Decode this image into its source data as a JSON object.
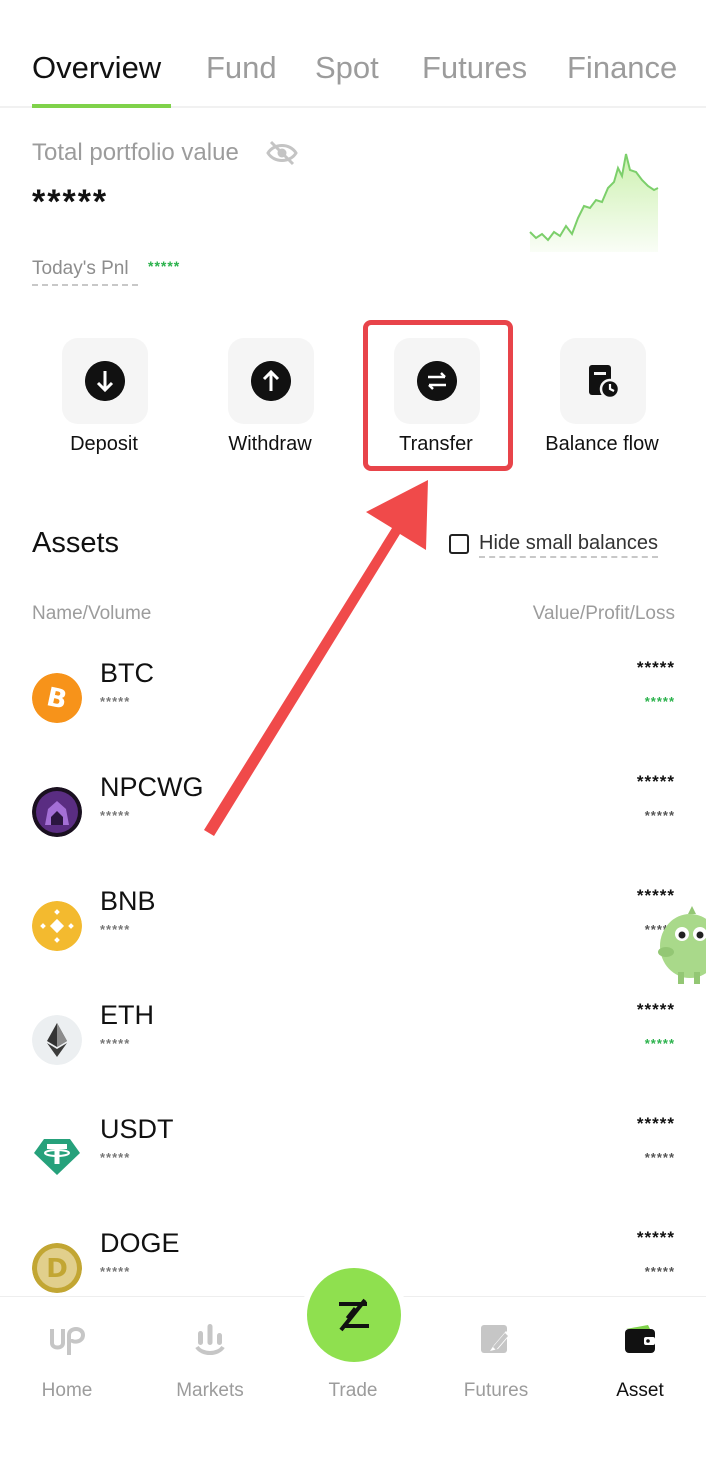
{
  "tabs": [
    {
      "label": "Overview",
      "active": true
    },
    {
      "label": "Fund",
      "active": false
    },
    {
      "label": "Spot",
      "active": false
    },
    {
      "label": "Futures",
      "active": false
    },
    {
      "label": "Finance",
      "active": false
    }
  ],
  "portfolio": {
    "label": "Total portfolio value",
    "value": "*****",
    "pnl_label": "Today's Pnl",
    "pnl_value": "*****"
  },
  "actions": [
    {
      "label": "Deposit",
      "icon": "arrow-down-icon"
    },
    {
      "label": "Withdraw",
      "icon": "arrow-up-icon"
    },
    {
      "label": "Transfer",
      "icon": "swap-icon"
    },
    {
      "label": "Balance flow",
      "icon": "balance-flow-icon"
    }
  ],
  "assets": {
    "title": "Assets",
    "hide_small_label": "Hide small balances",
    "col_left": "Name/Volume",
    "col_right": "Value/Profit/Loss",
    "items": [
      {
        "symbol": "BTC",
        "volume": "*****",
        "value": "*****",
        "pnl": "*****",
        "pnl_color": "green",
        "logo_color": "#f7931a"
      },
      {
        "symbol": "NPCWG",
        "volume": "*****",
        "value": "*****",
        "pnl": "*****",
        "pnl_color": "gray",
        "logo_color": "#3b1f4f"
      },
      {
        "symbol": "BNB",
        "volume": "*****",
        "value": "*****",
        "pnl": "*****",
        "pnl_color": "gray",
        "logo_color": "#f3ba2f"
      },
      {
        "symbol": "ETH",
        "volume": "*****",
        "value": "*****",
        "pnl": "*****",
        "pnl_color": "green",
        "logo_color": "#eceff1"
      },
      {
        "symbol": "USDT",
        "volume": "*****",
        "value": "*****",
        "pnl": "*****",
        "pnl_color": "gray",
        "logo_color": "#26a17b"
      },
      {
        "symbol": "DOGE",
        "volume": "*****",
        "value": "*****",
        "pnl": "*****",
        "pnl_color": "gray",
        "logo_color": "#c2a633"
      }
    ]
  },
  "nav": [
    {
      "label": "Home",
      "icon": "home-logo-icon",
      "active": false
    },
    {
      "label": "Markets",
      "icon": "markets-icon",
      "active": false
    },
    {
      "label": "Trade",
      "icon": "trade-icon",
      "active": false
    },
    {
      "label": "Futures",
      "icon": "futures-icon",
      "active": false
    },
    {
      "label": "Asset",
      "icon": "wallet-icon",
      "active": true
    }
  ],
  "colors": {
    "accent": "#8fe04f",
    "highlight": "#e8444a",
    "positive": "#2bb24c"
  }
}
